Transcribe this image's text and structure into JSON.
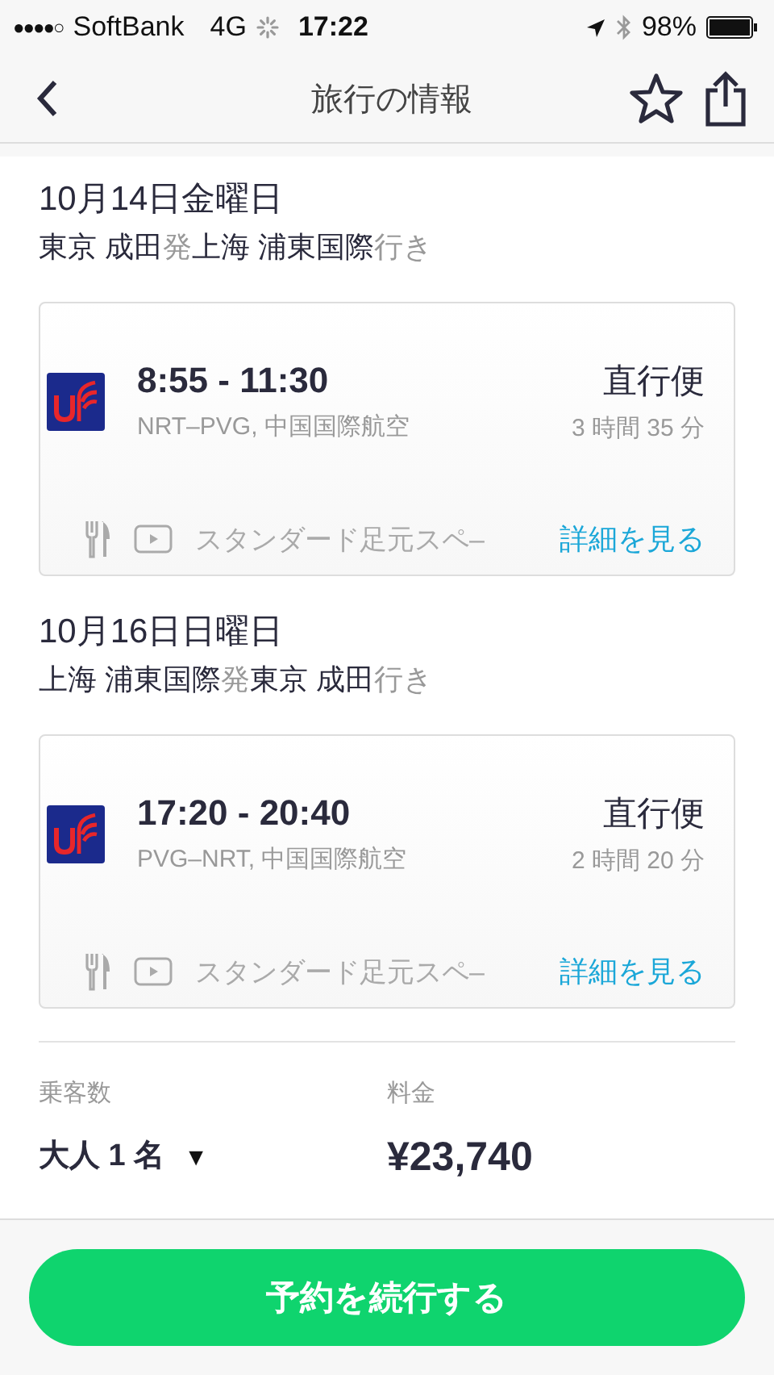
{
  "status_bar": {
    "signal": "●●●●○",
    "carrier": "SoftBank",
    "network": "4G",
    "time": "17:22",
    "battery": "98%"
  },
  "nav": {
    "title": "旅行の情報"
  },
  "flights": [
    {
      "date": "10月14日金曜日",
      "from": "東京 成田",
      "from_suffix": "発",
      "to": "上海 浦東国際",
      "to_suffix": "行き",
      "times": "8:55 - 11:30",
      "route": "NRT–PVG, 中国国際航空",
      "stops": "直行便",
      "duration": "3 時間 35 分",
      "amenity": "スタンダード足元スペ–",
      "details": "詳細を見る"
    },
    {
      "date": "10月16日日曜日",
      "from": "上海 浦東国際",
      "from_suffix": "発",
      "to": "東京 成田",
      "to_suffix": "行き",
      "times": "17:20 - 20:40",
      "route": "PVG–NRT, 中国国際航空",
      "stops": "直行便",
      "duration": "2 時間 20 分",
      "amenity": "スタンダード足元スペ–",
      "details": "詳細を見る"
    }
  ],
  "passengers": {
    "label": "乗客数",
    "value": "大人 1 名",
    "caret": "▼"
  },
  "price": {
    "label": "料金",
    "value": "¥23,740"
  },
  "continue_button": "予約を続行する"
}
